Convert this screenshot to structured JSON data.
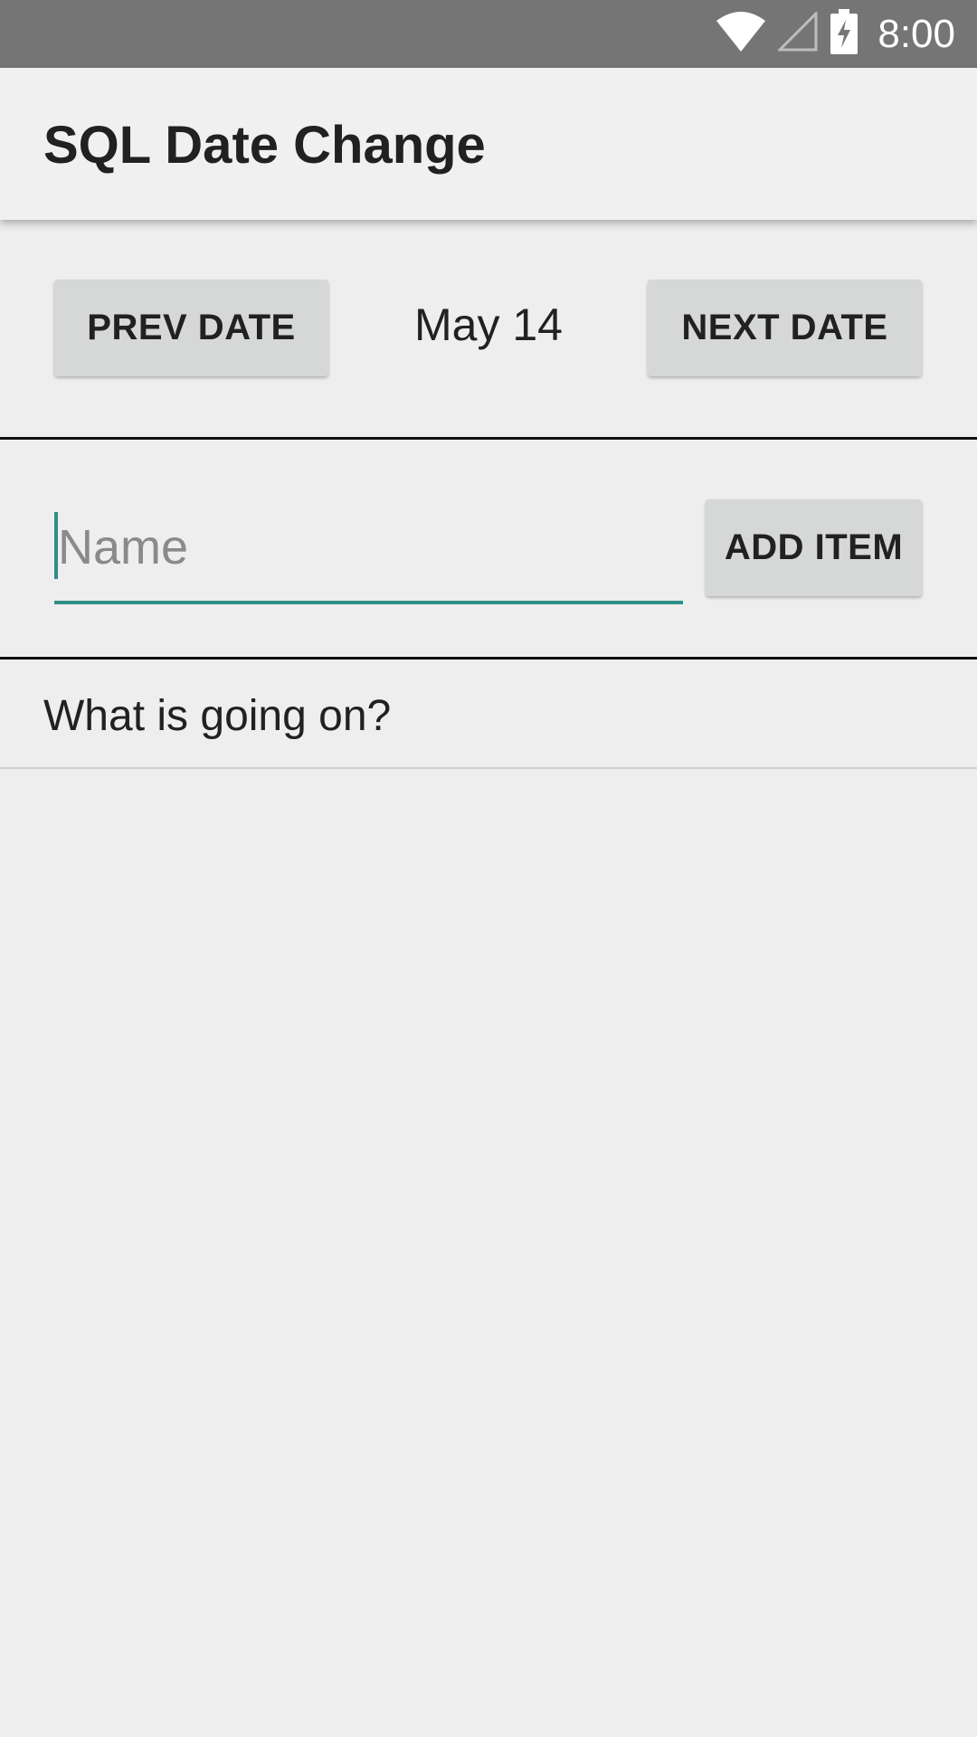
{
  "status_bar": {
    "time": "8:00",
    "icons": [
      "wifi-icon",
      "cell-signal-icon",
      "battery-charging-icon"
    ]
  },
  "app_bar": {
    "title": "SQL Date Change"
  },
  "date_nav": {
    "prev_label": "PREV DATE",
    "date": "May 14",
    "next_label": "NEXT DATE"
  },
  "add_form": {
    "name_placeholder": "Name",
    "name_value": "",
    "add_label": "ADD ITEM"
  },
  "items": [
    {
      "text": "What is going on?"
    }
  ],
  "colors": {
    "accent": "#2e8f86",
    "status_bar": "#757575",
    "app_bar": "#f0f0f0",
    "background": "#eeeeee",
    "button": "#d6d7d7"
  }
}
